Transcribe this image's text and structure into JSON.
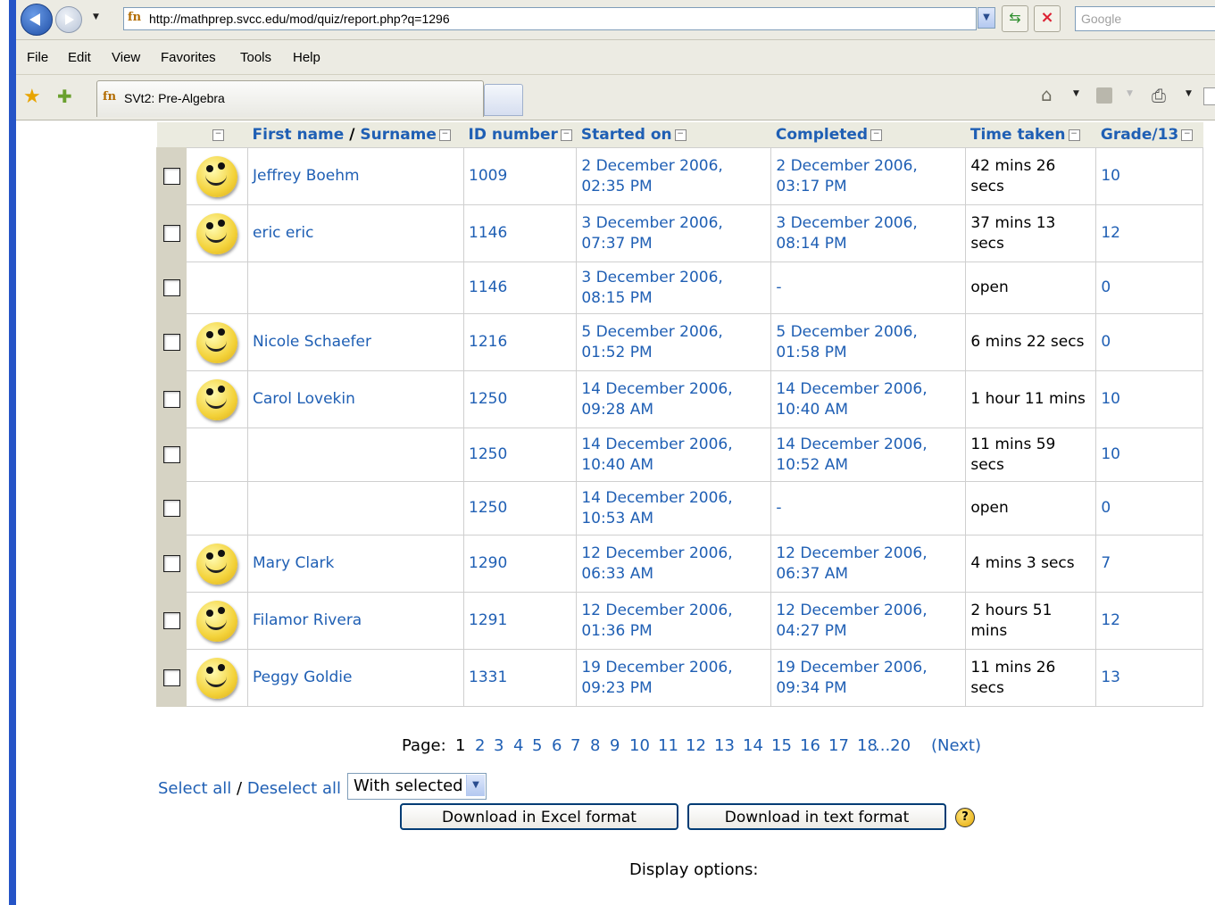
{
  "browser": {
    "url": "http://mathprep.svcc.edu/mod/quiz/report.php?q=1296",
    "search_placeholder": "Google",
    "tab_title": "SVt2: Pre-Algebra",
    "menu": [
      "File",
      "Edit",
      "View",
      "Favorites",
      "Tools",
      "Help"
    ]
  },
  "table": {
    "headers": {
      "name_first": "First name",
      "name_sep": " / ",
      "name_last": "Surname",
      "id": "ID number",
      "started": "Started on",
      "completed": "Completed",
      "time": "Time taken",
      "grade": "Grade/13"
    },
    "rows": [
      {
        "name": "Jeffrey Boehm",
        "avatar": true,
        "id": "1009",
        "started": "2 December 2006, 02:35 PM",
        "completed": "2 December 2006, 03:17 PM",
        "time": "42 mins 26 secs",
        "grade": "10"
      },
      {
        "name": "eric eric",
        "avatar": true,
        "id": "1146",
        "started": "3 December 2006, 07:37 PM",
        "completed": "3 December 2006, 08:14 PM",
        "time": "37 mins 13 secs",
        "grade": "12"
      },
      {
        "name": "",
        "avatar": false,
        "id": "1146",
        "started": "3 December 2006, 08:15 PM",
        "completed": "-",
        "time": "open",
        "grade": "0"
      },
      {
        "name": "Nicole Schaefer",
        "avatar": true,
        "id": "1216",
        "started": "5 December 2006, 01:52 PM",
        "completed": "5 December 2006, 01:58 PM",
        "time": "6 mins 22 secs",
        "grade": "0"
      },
      {
        "name": "Carol Lovekin",
        "avatar": true,
        "id": "1250",
        "started": "14 December 2006, 09:28 AM",
        "completed": "14 December 2006, 10:40 AM",
        "time": "1 hour 11 mins",
        "grade": "10"
      },
      {
        "name": "",
        "avatar": false,
        "id": "1250",
        "started": "14 December 2006, 10:40 AM",
        "completed": "14 December 2006, 10:52 AM",
        "time": "11 mins 59 secs",
        "grade": "10"
      },
      {
        "name": "",
        "avatar": false,
        "id": "1250",
        "started": "14 December 2006, 10:53 AM",
        "completed": "-",
        "time": "open",
        "grade": "0"
      },
      {
        "name": "Mary Clark",
        "avatar": true,
        "id": "1290",
        "started": "12 December 2006, 06:33 AM",
        "completed": "12 December 2006, 06:37 AM",
        "time": "4 mins 3 secs",
        "grade": "7"
      },
      {
        "name": "Filamor Rivera",
        "avatar": true,
        "id": "1291",
        "started": "12 December 2006, 01:36 PM",
        "completed": "12 December 2006, 04:27 PM",
        "time": "2 hours 51 mins",
        "grade": "12"
      },
      {
        "name": "Peggy Goldie",
        "avatar": true,
        "id": "1331",
        "started": "19 December 2006, 09:23 PM",
        "completed": "19 December 2006, 09:34 PM",
        "time": "11 mins 26 secs",
        "grade": "13"
      }
    ]
  },
  "pager": {
    "label": "Page:",
    "current": "1",
    "pages": [
      "2",
      "3",
      "4",
      "5",
      "6",
      "7",
      "8",
      "9",
      "10",
      "11",
      "12",
      "13",
      "14",
      "15",
      "16",
      "17",
      "18",
      "...20"
    ],
    "next": "(Next)"
  },
  "actions": {
    "select_all": "Select all",
    "deselect_all": "Deselect all",
    "with_selected": "With selected",
    "download_excel": "Download in Excel format",
    "download_text": "Download in text format",
    "display_options": "Display options:"
  }
}
